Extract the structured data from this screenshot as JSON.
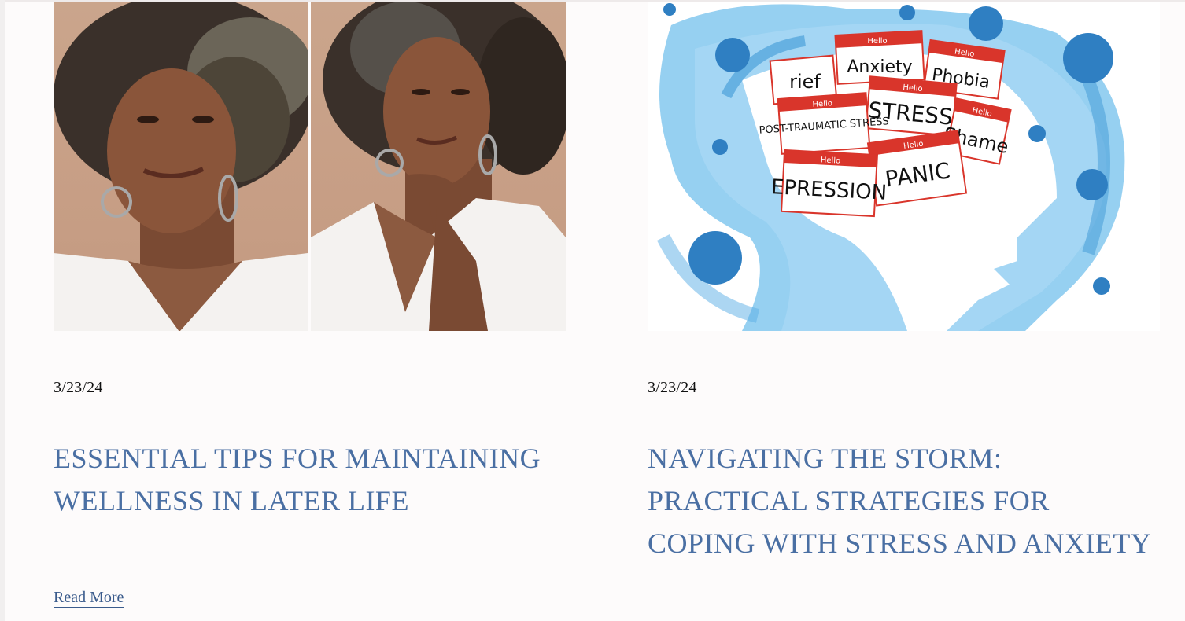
{
  "posts": [
    {
      "date": "3/23/24",
      "title": "ESSENTIAL TIPS FOR MAINTAINING WELLNESS IN LATER LIFE",
      "read_more": "Read More",
      "image_alt": "Two portraits of an older woman with gray curly hair wearing a white v-neck t-shirt"
    },
    {
      "date": "3/23/24",
      "title": "NAVIGATING THE STORM: PRACTICAL STRATEGIES FOR COPING WITH STRESS AND ANXIETY",
      "image_alt": "Blue watercolor head silhouette filled with name tags",
      "tags": [
        {
          "hello": "Hello",
          "word": "Anxiety"
        },
        {
          "hello": "Hello",
          "word": "Phobia"
        },
        {
          "hello": "",
          "word": "rief"
        },
        {
          "hello": "Hello",
          "word": "STRESS"
        },
        {
          "hello": "Hello",
          "word": "POST-TRAUMATIC STRESS"
        },
        {
          "hello": "Hello",
          "word": "Shame"
        },
        {
          "hello": "Hello",
          "word": "PANIC"
        },
        {
          "hello": "Hello",
          "word": "EPRESSION"
        }
      ]
    }
  ],
  "colors": {
    "title": "#4a6fa3",
    "link": "#3a5b8c",
    "background": "#fdfbfb",
    "tag_red": "#d9352b",
    "watercolor_blue": "#5eb3e6"
  }
}
